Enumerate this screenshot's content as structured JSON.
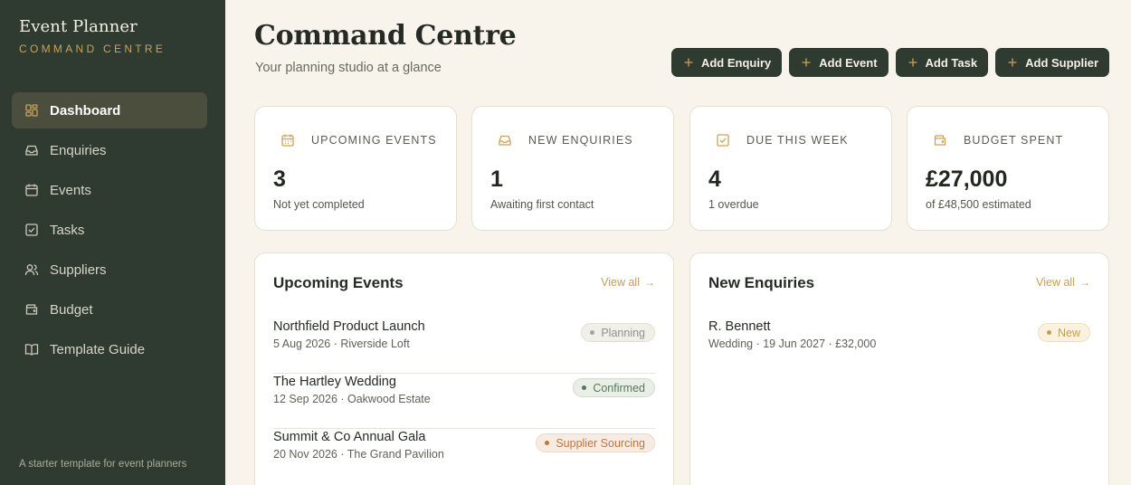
{
  "brand": {
    "title": "Event Planner",
    "subtitle": "COMMAND CENTRE"
  },
  "sidebar": {
    "items": [
      {
        "label": "Dashboard",
        "icon": "dashboard-grid-icon",
        "active": true
      },
      {
        "label": "Enquiries",
        "icon": "inbox-icon"
      },
      {
        "label": "Events",
        "icon": "calendar-icon"
      },
      {
        "label": "Tasks",
        "icon": "checkbox-icon"
      },
      {
        "label": "Suppliers",
        "icon": "users-icon"
      },
      {
        "label": "Budget",
        "icon": "wallet-icon"
      },
      {
        "label": "Template Guide",
        "icon": "book-icon"
      }
    ],
    "footer": "A starter template for event planners"
  },
  "header": {
    "title": "Command Centre",
    "subtitle": "Your planning studio at a glance",
    "actions": [
      {
        "label": "Add Enquiry"
      },
      {
        "label": "Add Event"
      },
      {
        "label": "Add Task"
      },
      {
        "label": "Add Supplier"
      }
    ]
  },
  "stats": [
    {
      "label": "UPCOMING EVENTS",
      "value": "3",
      "note": "Not yet completed",
      "icon": "calendar-icon"
    },
    {
      "label": "NEW ENQUIRIES",
      "value": "1",
      "note": "Awaiting first contact",
      "icon": "inbox-icon"
    },
    {
      "label": "DUE THIS WEEK",
      "value": "4",
      "note": "1 overdue",
      "icon": "checkbox-icon"
    },
    {
      "label": "BUDGET SPENT",
      "value": "£27,000",
      "note": "of £48,500 estimated",
      "icon": "wallet-icon"
    }
  ],
  "upcoming": {
    "title": "Upcoming Events",
    "view_all": "View all",
    "rows": [
      {
        "title": "Northfield Product Launch",
        "sub": "5 Aug 2026 · Riverside Loft",
        "status": "Planning"
      },
      {
        "title": "The Hartley Wedding",
        "sub": "12 Sep 2026 · Oakwood Estate",
        "status": "Confirmed"
      },
      {
        "title": "Summit & Co Annual Gala",
        "sub": "20 Nov 2026 · The Grand Pavilion",
        "status": "Supplier Sourcing"
      }
    ]
  },
  "enquiries": {
    "title": "New Enquiries",
    "view_all": "View all",
    "rows": [
      {
        "title": "R. Bennett",
        "sub": "Wedding · 19 Jun 2027 · £32,000",
        "status": "New"
      }
    ]
  },
  "colors": {
    "sidebar_bg": "#2f3a30",
    "accent_gold": "#c9a35a",
    "planning": "#8f948a",
    "confirmed": "#55795a",
    "sourcing": "#c0743e",
    "new": "#c79d55"
  }
}
